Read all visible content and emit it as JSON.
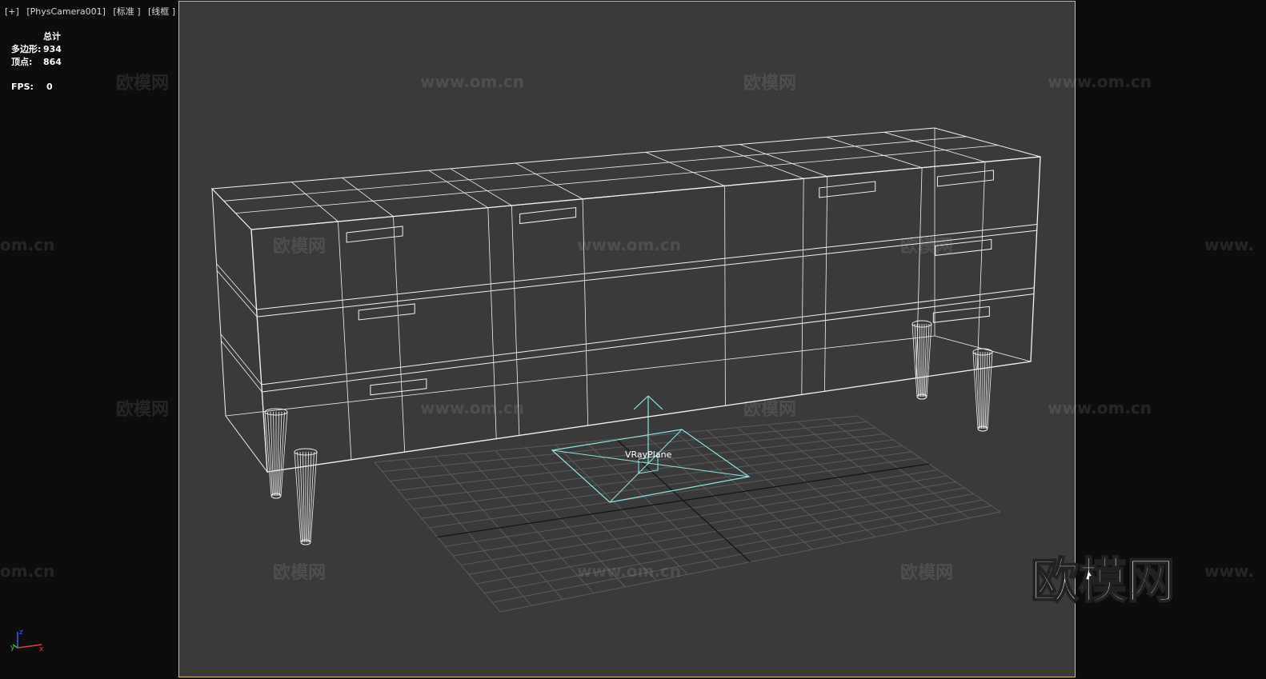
{
  "viewport": {
    "labels": [
      "[+]",
      "[PhysCamera001]",
      "[标准 ]",
      "[线框 ]"
    ]
  },
  "stats": {
    "header": "总计",
    "polygons_label": "多边形:",
    "polygons_value": "934",
    "vertices_label": "顶点:",
    "vertices_value": "864",
    "fps_label": "FPS:",
    "fps_value": "0"
  },
  "scene": {
    "object_label": "VRayPlane",
    "wire_color": "#f2f2f2",
    "grid_color": "#5a5a5a",
    "plane_color": "#8fe3e3",
    "frame_color": "#d8c84a",
    "background": "#3a3a3a"
  },
  "watermarks": {
    "brand": "欧模网",
    "url": "www.om.cn",
    "url_partial": "om.cn",
    "url_start": "www."
  },
  "axis_gizmo": {
    "x": "x",
    "y": "y",
    "z": "z"
  }
}
